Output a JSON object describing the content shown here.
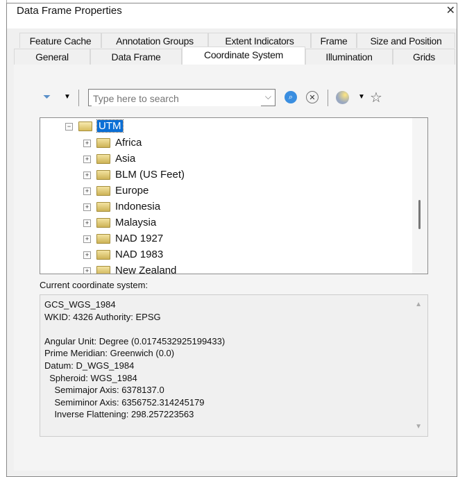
{
  "window": {
    "title": "Data Frame Properties",
    "close": "✕"
  },
  "tabs_row1": [
    "Feature Cache",
    "Annotation Groups",
    "Extent Indicators",
    "Frame",
    "Size and Position"
  ],
  "tabs_row2": [
    "General",
    "Data Frame",
    "Coordinate System",
    "Illumination",
    "Grids"
  ],
  "active_tab": "Coordinate System",
  "toolbar": {
    "search_placeholder": "Type here to search"
  },
  "tree": {
    "parent": "UTM",
    "children": [
      "Africa",
      "Asia",
      "BLM (US Feet)",
      "Europe",
      "Indonesia",
      "Malaysia",
      "NAD 1927",
      "NAD 1983",
      "New Zealand"
    ]
  },
  "current": {
    "label": "Current coordinate system:",
    "lines": [
      "GCS_WGS_1984",
      "WKID: 4326 Authority: EPSG",
      "",
      "Angular Unit: Degree (0.0174532925199433)",
      "Prime Meridian: Greenwich (0.0)",
      "Datum: D_WGS_1984",
      "  Spheroid: WGS_1984",
      "    Semimajor Axis: 6378137.0",
      "    Semiminor Axis: 6356752.314245179",
      "    Inverse Flattening: 298.257223563"
    ]
  }
}
